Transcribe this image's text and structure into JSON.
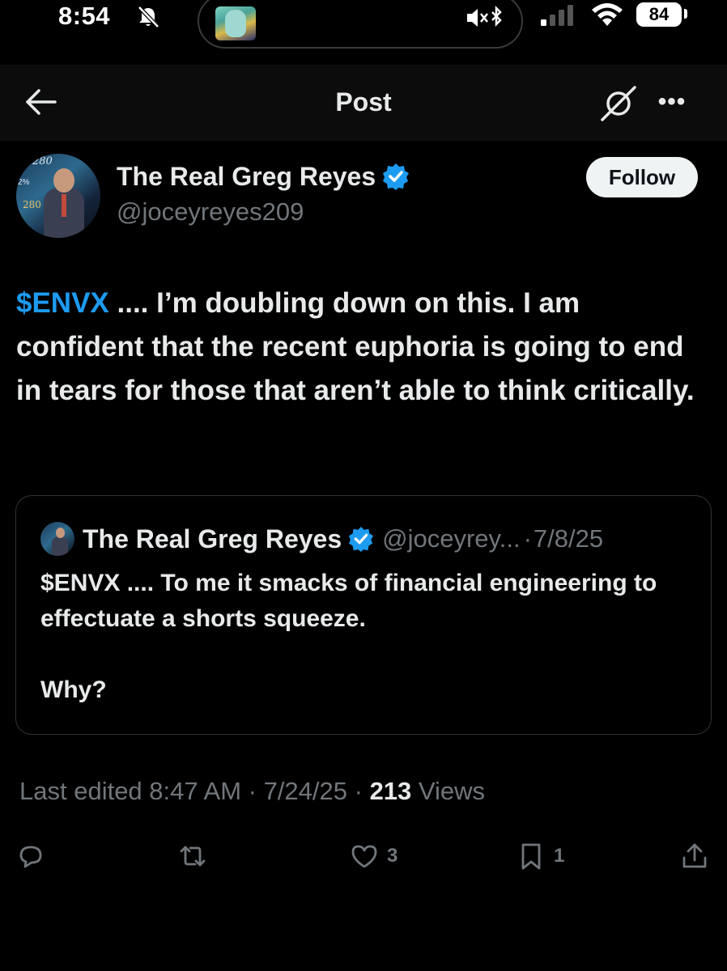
{
  "status_bar": {
    "time": "8:54",
    "battery": "84"
  },
  "nav": {
    "title": "Post"
  },
  "author": {
    "name": "The Real Greg Reyes",
    "handle": "@joceyreyes209",
    "follow_label": "Follow"
  },
  "tweet": {
    "cashtag": "$ENVX",
    "text": " .... I’m doubling down on this. I am confident that the recent euphoria is going to end in tears for those that aren’t able to think critically."
  },
  "quote": {
    "name": "The Real Greg Reyes",
    "handle": "@joceyrey...",
    "date": "7/8/25",
    "text_line1": "$ENVX .... To me it smacks of financial engineering to effectuate a shorts squeeze.",
    "text_line2": "Why?"
  },
  "meta": {
    "edited": "Last edited 8:47 AM · 7/24/25",
    "views_count": "213",
    "views_label": "Views"
  },
  "actions": {
    "likes": "3",
    "bookmarks": "1"
  },
  "colors": {
    "accent": "#1d9bf0",
    "background": "#000000",
    "muted": "#71767b"
  }
}
